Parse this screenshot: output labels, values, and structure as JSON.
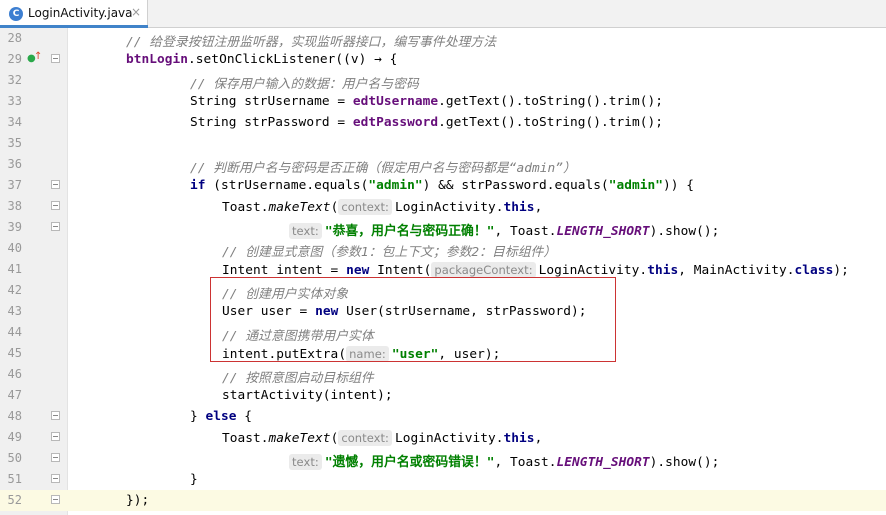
{
  "tab": {
    "icon_letter": "C",
    "title": "LoginActivity.java",
    "close": "×"
  },
  "gutter_marks": {
    "override": "●",
    "arrow": "↑"
  },
  "code": {
    "l28_num": "28",
    "l28_t1": "// 给登录按钮注册监听器，实现监听器接口，编写事件处理方法",
    "l29_num": "29",
    "l29_t1": "btnLogin",
    "l29_t2": ".setOnClickListener((v) ",
    "l29_t3": "→",
    "l29_t4": " {",
    "l32_num": "32",
    "l32_t1": "// 保存用户输入的数据：用户名与密码",
    "l33_num": "33",
    "l33_t1": "String strUsername = ",
    "l33_t2": "edtUsername",
    "l33_t3": ".getText().toString().trim();",
    "l34_num": "34",
    "l34_t1": "String strPassword = ",
    "l34_t2": "edtPassword",
    "l34_t3": ".getText().toString().trim();",
    "l35_num": "35",
    "l36_num": "36",
    "l36_t1": "// 判断用户名与密码是否正确（假定用户名与密码都是“admin”）",
    "l37_num": "37",
    "l37_t1": "if",
    "l37_t2": " (strUsername.equals(",
    "l37_t3": "\"admin\"",
    "l37_t4": ") && strPassword.equals(",
    "l37_t5": "\"admin\"",
    "l37_t6": ")) {",
    "l38_num": "38",
    "l38_t1": "Toast.",
    "l38_t2": "makeText",
    "l38_t3": "(",
    "l38_hint": "context:",
    "l38_t4": "LoginActivity.",
    "l38_t5": "this",
    "l38_t6": ",",
    "l39_num": "39",
    "l39_hint": "text:",
    "l39_t1": "\"恭喜，用户名与密码正确！\"",
    "l39_t2": ", Toast.",
    "l39_t3": "LENGTH_SHORT",
    "l39_t4": ").show();",
    "l40_num": "40",
    "l40_t1": "// 创建显式意图（参数1：包上下文；参数2：目标组件）",
    "l41_num": "41",
    "l41_t1": "Intent intent = ",
    "l41_t2": "new",
    "l41_t3": " Intent(",
    "l41_hint": "packageContext:",
    "l41_t4": "LoginActivity.",
    "l41_t5": "this",
    "l41_t6": ", MainActivity.",
    "l41_t7": "class",
    "l41_t8": ");",
    "l42_num": "42",
    "l42_t1": "// 创建用户实体对象",
    "l43_num": "43",
    "l43_t1": "User user = ",
    "l43_t2": "new",
    "l43_t3": " User(strUsername, strPassword);",
    "l44_num": "44",
    "l44_t1": "// 通过意图携带用户实体",
    "l45_num": "45",
    "l45_t1": "intent.putExtra(",
    "l45_hint": "name:",
    "l45_t2": "\"user\"",
    "l45_t3": ", user);",
    "l46_num": "46",
    "l46_t1": "// 按照意图启动目标组件",
    "l47_num": "47",
    "l47_t1": "startActivity(intent);",
    "l48_num": "48",
    "l48_t1": "} ",
    "l48_t2": "else",
    "l48_t3": " {",
    "l49_num": "49",
    "l49_t1": "Toast.",
    "l49_t2": "makeText",
    "l49_t3": "(",
    "l49_hint": "context:",
    "l49_t4": "LoginActivity.",
    "l49_t5": "this",
    "l49_t6": ",",
    "l50_num": "50",
    "l50_hint": "text:",
    "l50_t1": "\"遗憾，用户名或密码错误！\"",
    "l50_t2": ", Toast.",
    "l50_t3": "LENGTH_SHORT",
    "l50_t4": ").show();",
    "l51_num": "51",
    "l51_t1": "}",
    "l52_num": "52",
    "l52_t1": "});"
  },
  "colors": {
    "keyword": "#000080",
    "string": "#008000",
    "field": "#660e7a",
    "comment": "#808080",
    "highlight_box": "#cc3333",
    "current_line": "#fcfae3"
  }
}
